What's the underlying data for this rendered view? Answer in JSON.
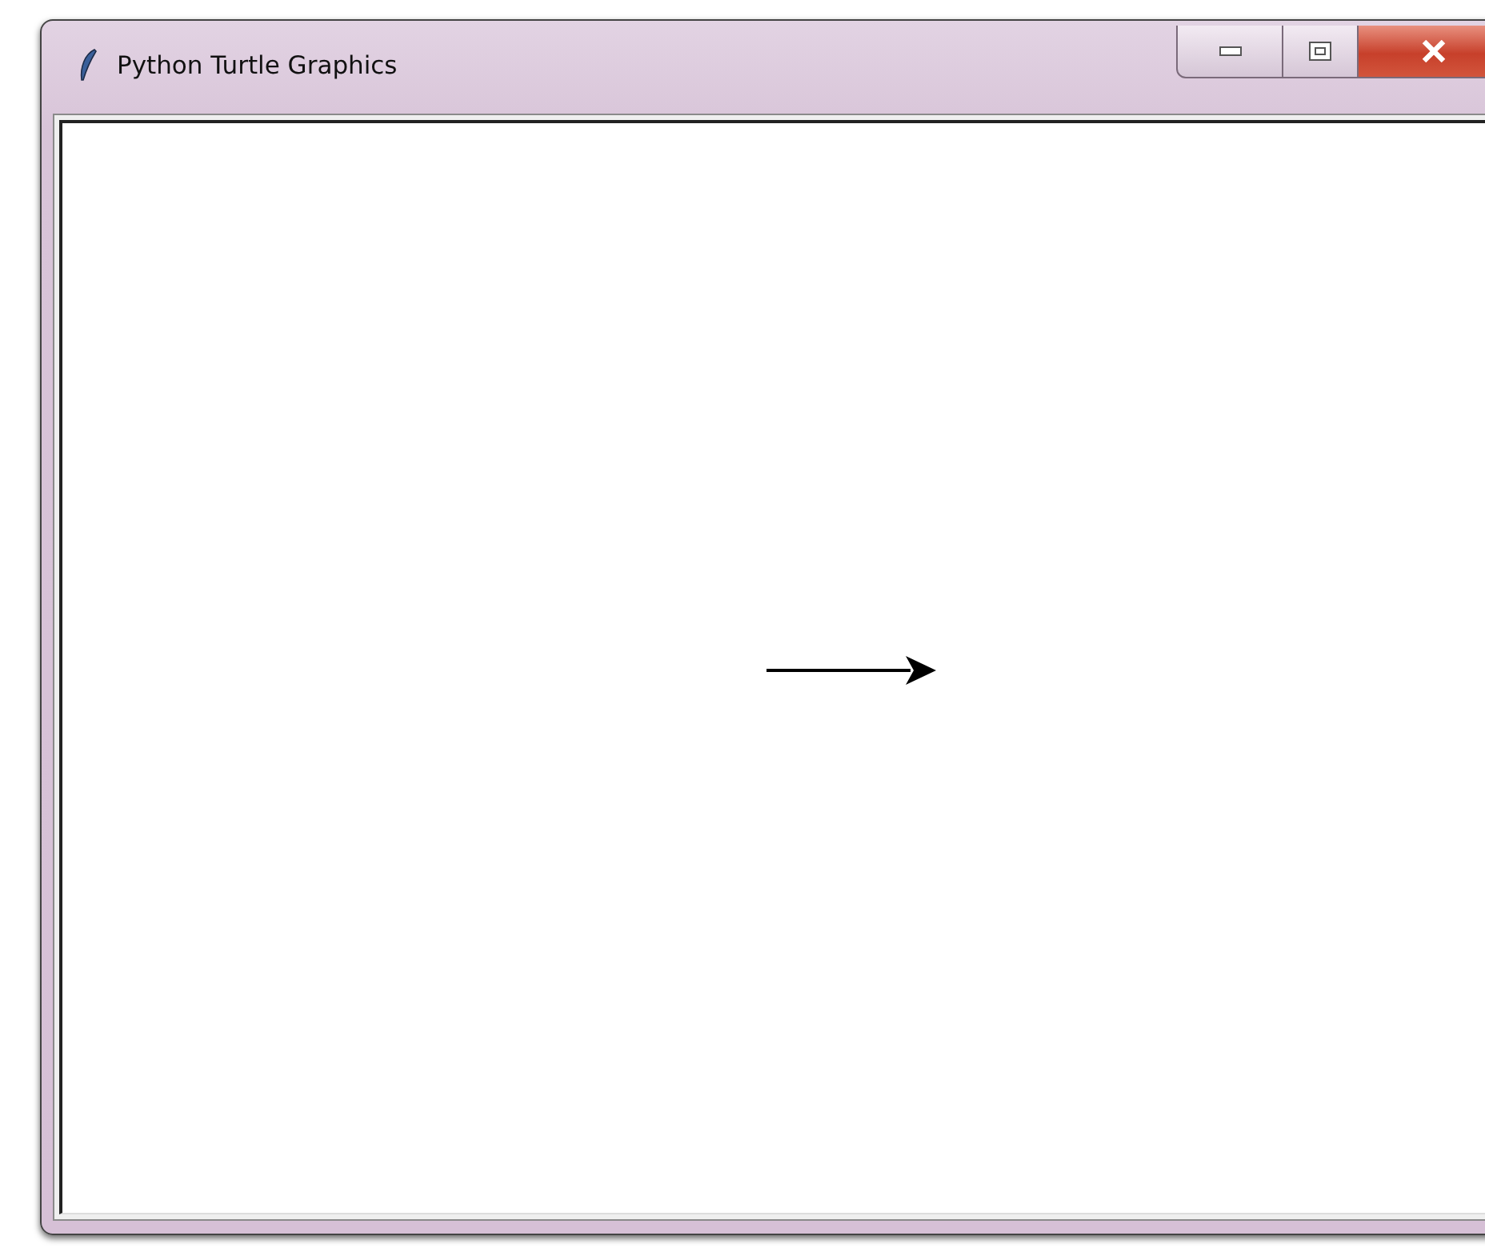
{
  "window": {
    "title": "Python Turtle Graphics",
    "controls": [
      {
        "kind": "minimize"
      },
      {
        "kind": "maximize"
      },
      {
        "kind": "close"
      }
    ]
  }
}
